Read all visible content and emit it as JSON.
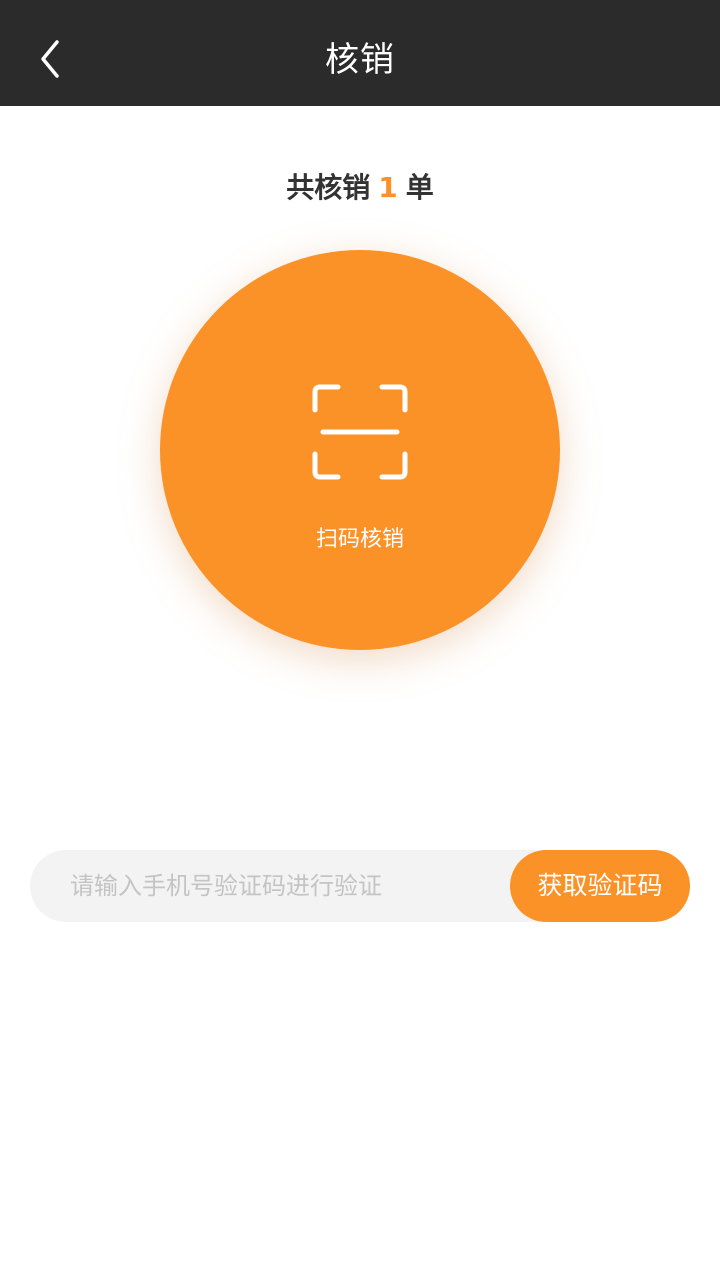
{
  "header": {
    "title": "核销",
    "back_icon": "chevron-left-icon"
  },
  "summary": {
    "prefix": "共核销",
    "count": "1",
    "suffix": "单"
  },
  "scan": {
    "icon": "scan-frame-icon",
    "label": "扫码核销"
  },
  "verify": {
    "placeholder": "请输入手机号验证码进行验证",
    "value": "",
    "button_label": "获取验证码"
  },
  "colors": {
    "header_bg": "#2b2b2b",
    "accent": "#fb9228",
    "input_bg": "#f3f3f3",
    "placeholder": "#c4c4c4",
    "text_dark": "#333333"
  }
}
